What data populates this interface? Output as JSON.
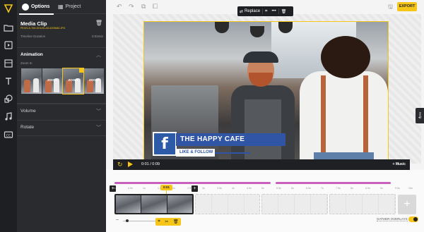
{
  "rail": {
    "icons": [
      "logo-icon",
      "folder-icon",
      "video-icon",
      "layout-icon",
      "text-icon",
      "shapes-icon",
      "music-icon",
      "captions-icon"
    ]
  },
  "panel": {
    "tabs": [
      {
        "label": "Options",
        "icon": "options-icon"
      },
      {
        "label": "Project",
        "icon": "project-icon"
      }
    ],
    "media_title": "Media Clip",
    "file_name": "PEXELS-TIM-DOUGLAS-6205680.JPG",
    "timeline_duration_label": "Timeline Duration",
    "timeline_duration_value": "0:02min",
    "animation_label": "Animation",
    "zoom_in_label": "Zoom In",
    "thumbs": [
      "",
      "ZOOM",
      "ZOOM",
      "ZOOM"
    ],
    "volume_label": "Volume",
    "rotate_label": "Rotate"
  },
  "topbar": {
    "export_label": "EXPORT"
  },
  "canvas_toolbar": {
    "replace_label": "Replace"
  },
  "lower_third": {
    "title": "THE HAPPY CAFE",
    "subtitle": "LIKE & FOLLOW",
    "fb_letter": "f"
  },
  "help_label": "Help",
  "player": {
    "time": "0:01 / 0:09",
    "music_label": "+ Music"
  },
  "timeline": {
    "playhead_time": "0:01",
    "ticks": [
      "0s",
      "0.5s",
      "1s",
      "1.5s",
      "2s",
      "2.5s",
      "3s",
      "3.5s",
      "4s",
      "4.5s",
      "5s",
      "5.5s",
      "6s",
      "6.5s",
      "7s",
      "7.5s",
      "8s",
      "8.5s",
      "9s",
      "9.5s",
      "10s"
    ],
    "gather_label": "GATHER OVERLAYS",
    "gather_on": true
  },
  "colors": {
    "accent": "#f5c518",
    "overlay_bar": "#c95fbd",
    "brand_blue": "#2f55a4"
  }
}
